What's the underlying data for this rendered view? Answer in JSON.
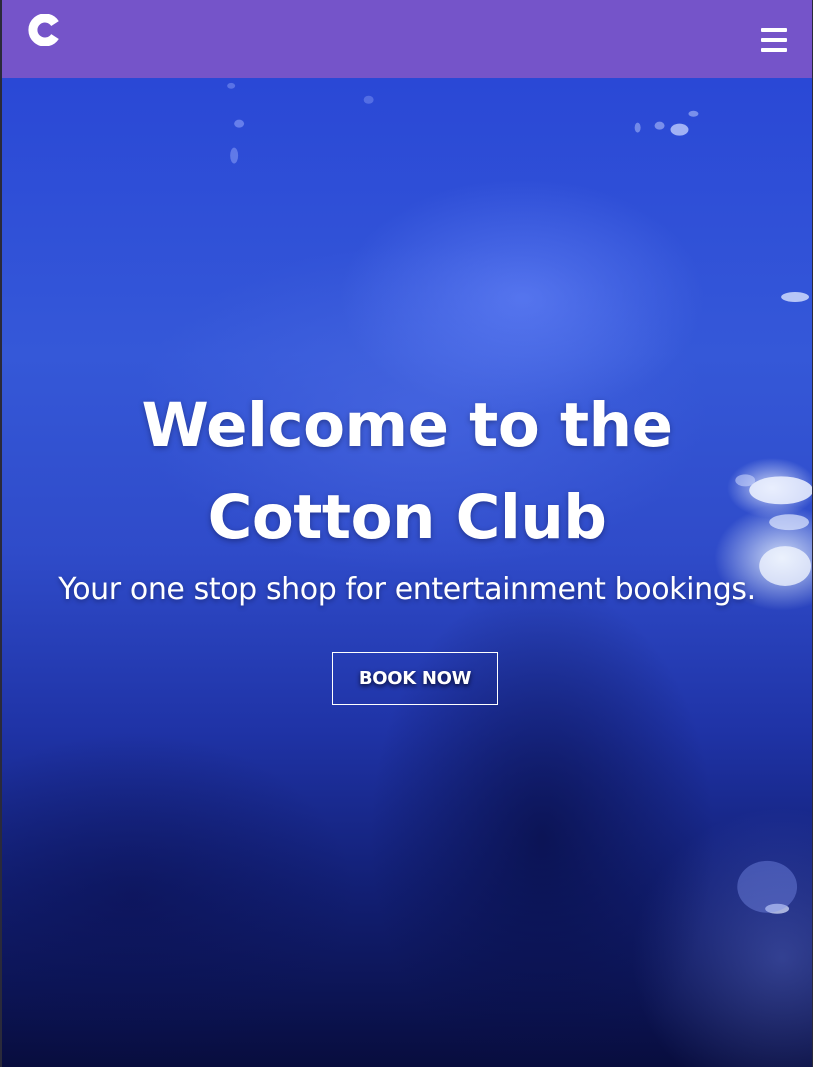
{
  "navbar": {
    "logo_icon": "cotton-club-logo-c",
    "menu_icon": "hamburger-menu-icon",
    "background": "#7554c9"
  },
  "hero": {
    "title": "Welcome to the Cotton Club",
    "subtitle": "Your one stop shop for entertainment bookings.",
    "cta_label": "BOOK NOW"
  }
}
